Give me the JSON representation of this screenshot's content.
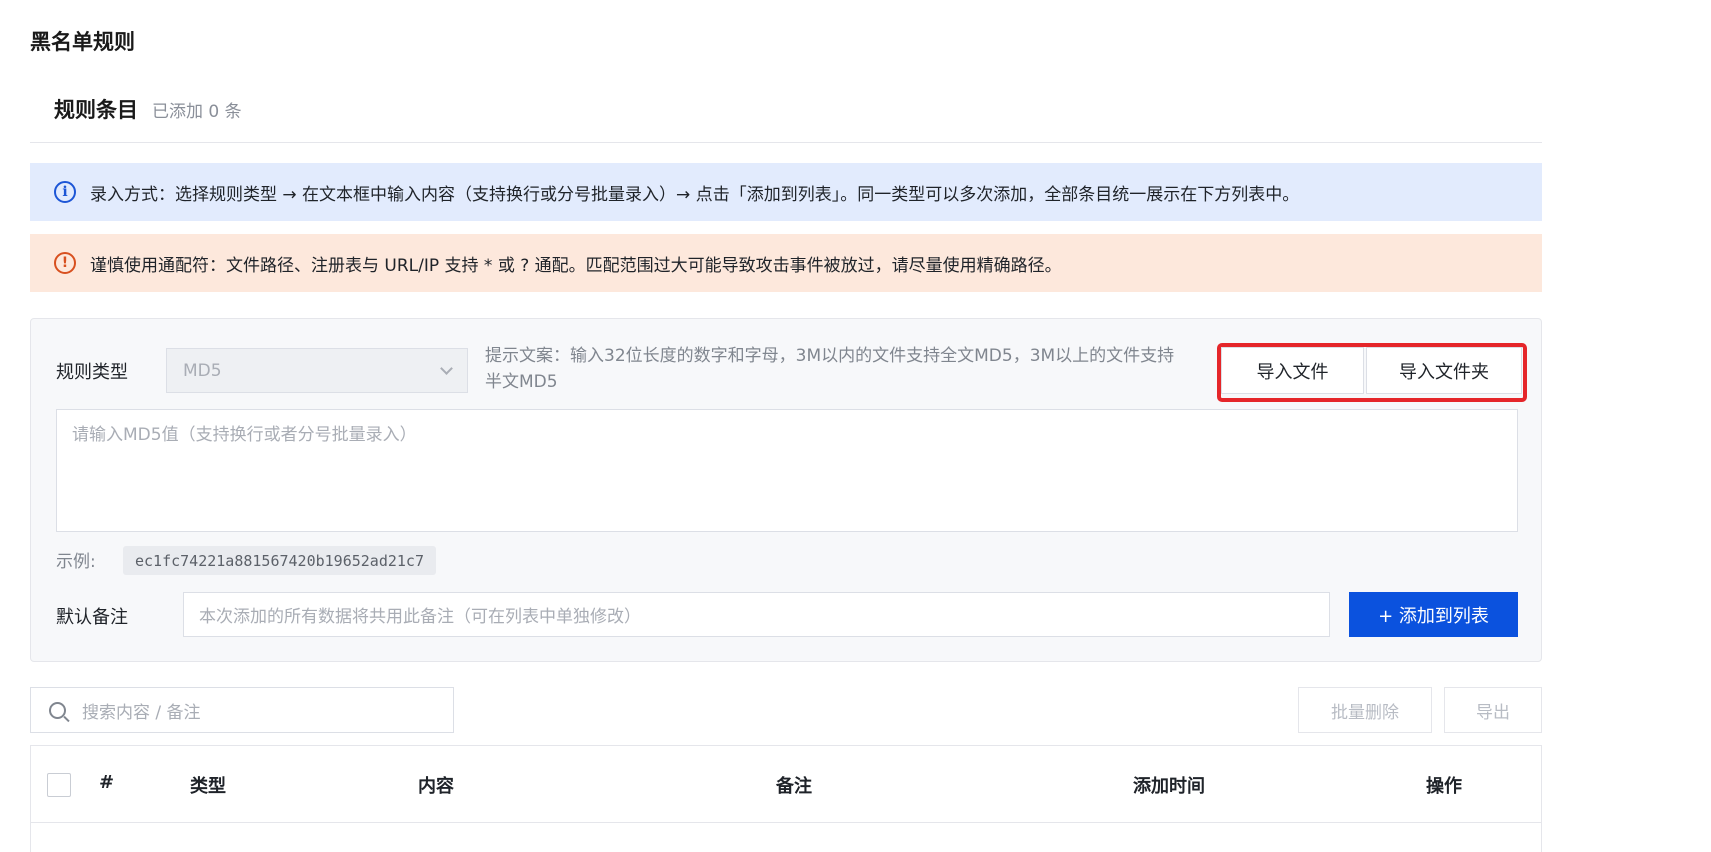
{
  "page": {
    "title": "黑名单规则"
  },
  "section": {
    "title": "规则条目",
    "count_text": "已添加 0 条"
  },
  "alerts": {
    "info_icon": "info-icon",
    "info_text": "录入方式：选择规则类型 → 在文本框中输入内容（支持换行或分号批量录入）→ 点击「添加到列表」。同一类型可以多次添加，全部条目统一展示在下方列表中。",
    "warn_icon": "warning-icon",
    "warn_text": "谨慎使用通配符：文件路径、注册表与 URL/IP 支持 * 或 ? 通配。匹配范围过大可能导致攻击事件被放过，请尽量使用精确路径。"
  },
  "form": {
    "rule_type_label": "规则类型",
    "rule_type_value": "MD5",
    "hint_line1": "提示文案：输入32位长度的数字和字母，3M以内的文件支持全文MD5，3M以上的文件支持",
    "hint_line2": "半文MD5",
    "import_file_label": "导入文件",
    "import_folder_label": "导入文件夹",
    "content_placeholder": "请输入MD5值（支持换行或者分号批量录入）",
    "example_label": "示例:",
    "example_value": "ec1fc74221a881567420b19652ad21c7",
    "remark_label": "默认备注",
    "remark_placeholder": "本次添加的所有数据将共用此备注（可在列表中单独修改）",
    "add_button_label": "+ 添加到列表"
  },
  "list": {
    "search_placeholder": "搜索内容 / 备注",
    "batch_delete_label": "批量删除",
    "export_label": "导出",
    "columns": [
      "#",
      "类型",
      "内容",
      "备注",
      "添加时间",
      "操作"
    ]
  },
  "colors": {
    "accent": "#0b52de",
    "highlight": "#e5262a",
    "info_bg": "#e2ebfd",
    "warn_bg": "#fde8dc"
  }
}
